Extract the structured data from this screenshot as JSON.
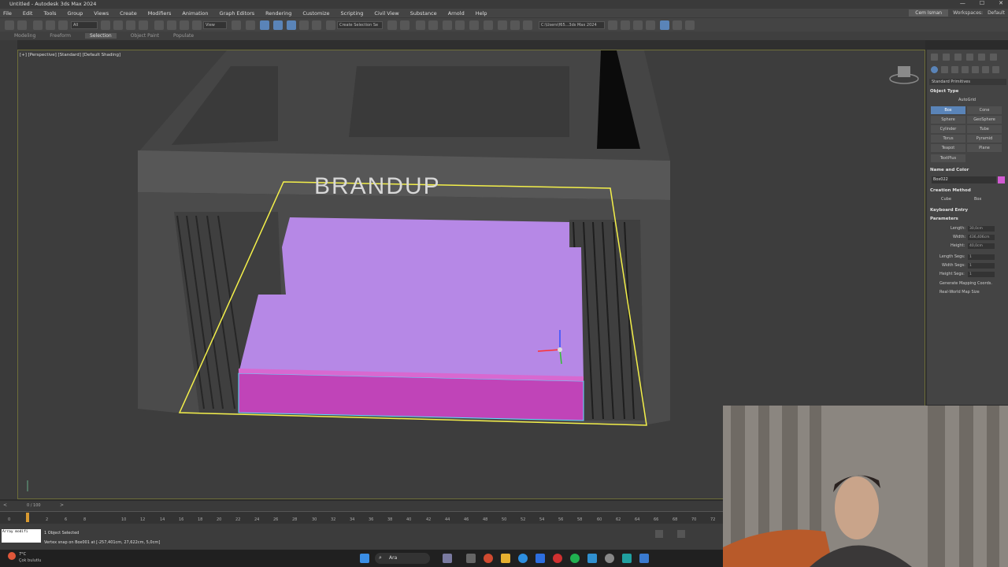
{
  "window": {
    "title": "Untitled - Autodesk 3ds Max 2024",
    "controls": [
      "—",
      "☐",
      "✕"
    ]
  },
  "menubar": {
    "items": [
      "File",
      "Edit",
      "Tools",
      "Group",
      "Views",
      "Create",
      "Modifiers",
      "Animation",
      "Graph Editors",
      "Rendering",
      "Customize",
      "Scripting",
      "Civil View",
      "Substance",
      "Arnold",
      "Help"
    ],
    "sign_in": "Cem Isman",
    "workspaces_label": "Workspaces:",
    "workspace_value": "Default"
  },
  "toolbar": {
    "filter": "All",
    "view_dropdown": "View",
    "selection_set": "Create Selection Se",
    "path": "C:\\Users\\f65...3ds Max 2024"
  },
  "ribbon": {
    "tabs": [
      "Modeling",
      "Freeform",
      "Selection",
      "Object Paint",
      "Populate"
    ],
    "active": "Selection"
  },
  "viewport": {
    "label": "[+] [Perspective] [Standard] [Default Shading]",
    "sign_text": "BRANDUP"
  },
  "command_panel": {
    "category": "Standard Primitives",
    "object_type_title": "Object Type",
    "autogrid": "AutoGrid",
    "buttons": [
      "Box",
      "Cone",
      "Sphere",
      "GeoSphere",
      "Cylinder",
      "Tube",
      "Torus",
      "Pyramid",
      "Teapot",
      "Plane",
      "TextPlus"
    ],
    "name_color_title": "Name and Color",
    "object_name": "Box022",
    "creation_method_title": "Creation Method",
    "creation_methods": [
      "Cube",
      "Box"
    ],
    "keyboard_entry_title": "Keyboard Entry",
    "parameters_title": "Parameters",
    "length_label": "Length:",
    "length_value": "30,0cm",
    "width_label": "Width:",
    "width_value": "436,406cm",
    "height_label": "Height:",
    "height_value": "40,0cm",
    "length_segs_label": "Length Segs:",
    "length_segs_value": "1",
    "width_segs_label": "Width Segs:",
    "width_segs_value": "1",
    "height_segs_label": "Height Segs:",
    "height_segs_value": "1",
    "gen_mapping": "Generate Mapping Coords.",
    "real_world": "Real-World Map Size",
    "swatch_color": "#d25ad2"
  },
  "timeline": {
    "frame_label": "0 / 100",
    "ticks": [
      "0",
      "2",
      "6",
      "8",
      "10",
      "12",
      "14",
      "16",
      "18",
      "20",
      "22",
      "24",
      "26",
      "28",
      "30",
      "32",
      "34",
      "36",
      "38",
      "40",
      "42",
      "44",
      "46",
      "48",
      "50",
      "52",
      "54",
      "56",
      "58",
      "60",
      "62",
      "64",
      "66",
      "68",
      "70",
      "72"
    ]
  },
  "status": {
    "script_box": "Array modifi",
    "selected": "1 Object Selected",
    "message": "Vertex snap on Box001 at [-257,401cm, 27,622cm, 5,0cm]",
    "weather_temp": "7°C",
    "weather_desc": "Çok bulutlu",
    "taskbar_search": "Ara"
  },
  "colors": {
    "accent": "#5a84b8",
    "selection_yellow": "#f4f04a",
    "object_purple": "#b688e6",
    "object_magenta": "#c044b8"
  }
}
